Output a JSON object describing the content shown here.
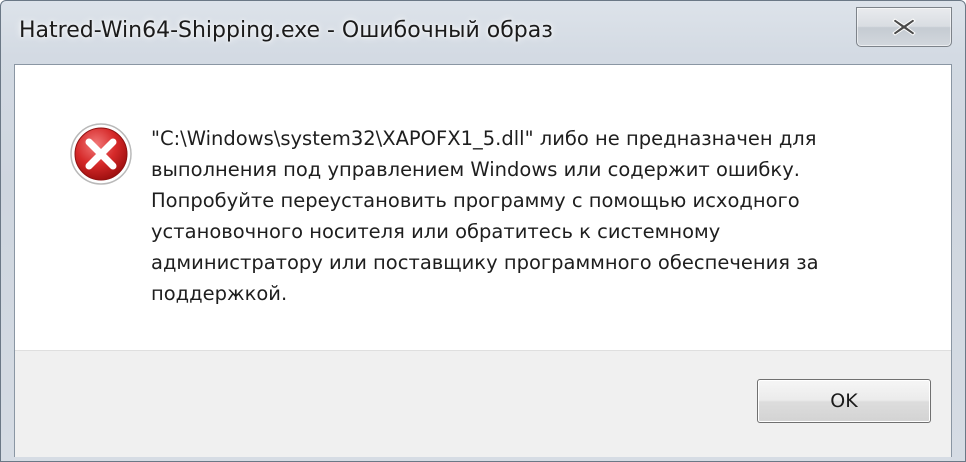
{
  "window": {
    "title": "Hatred-Win64-Shipping.exe - Ошибочный образ"
  },
  "titlebar": {
    "close_icon": "close-icon"
  },
  "dialog": {
    "icon": "error-icon",
    "message": "\"C:\\Windows\\system32\\XAPOFX1_5.dll\" либо не предназначен для\nвыполнения под управлением Windows или содержит ошибку.\nПопробуйте переустановить программу с помощью исходного\nустановочного носителя или обратитесь к системному\nадминистратору или поставщику программного обеспечения за\nподдержкой."
  },
  "buttons": {
    "ok_label": "OK"
  },
  "colors": {
    "error_red": "#d62a2a",
    "close_glyph": "#4a4a4a"
  }
}
